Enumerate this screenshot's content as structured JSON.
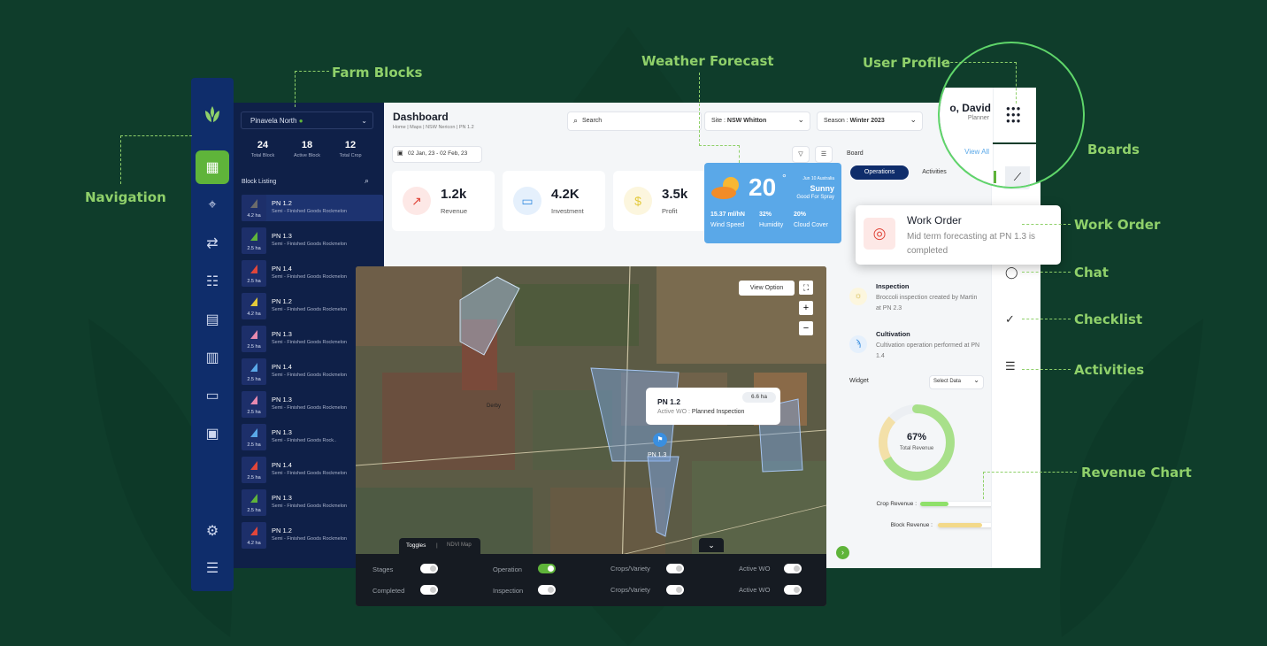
{
  "callouts": {
    "farm_blocks": "Farm Blocks",
    "weather": "Weather Forecast",
    "user_profile": "User Profile",
    "navigation": "Navigation",
    "boards": "Boards",
    "work_order": "Work Order",
    "chat": "Chat",
    "checklist": "Checklist",
    "activities": "Activities",
    "revenue_chart": "Revenue Chart"
  },
  "nav": {
    "icons": [
      "grid-icon",
      "map-pin-icon",
      "route-icon",
      "checklist-icon",
      "document-icon",
      "bar-chart-icon",
      "chat-icon",
      "calendar-icon",
      "settings-icon",
      "menu-icon"
    ]
  },
  "blocks": {
    "farm_select": "Pinavela North",
    "stats": [
      {
        "value": "24",
        "label": "Total Block"
      },
      {
        "value": "18",
        "label": "Active Block"
      },
      {
        "value": "12",
        "label": "Total Crop"
      }
    ],
    "listing_title": "Block Listing",
    "items": [
      {
        "name": "PN 1.2",
        "desc": "Semi - Finished Goods Rockmelon",
        "area": "4.2 ha",
        "color": "#6b6b6b"
      },
      {
        "name": "PN 1.3",
        "desc": "Semi - Finished Goods Rockmelon",
        "area": "2.5 ha",
        "color": "#5fb43a"
      },
      {
        "name": "PN 1.4",
        "desc": "Semi - Finished Goods Rockmelon",
        "area": "2.5 ha",
        "color": "#e0463a"
      },
      {
        "name": "PN 1.2",
        "desc": "Semi - Finished Goods Rockmelon",
        "area": "4.2 ha",
        "color": "#e3c93a"
      },
      {
        "name": "PN 1.3",
        "desc": "Semi - Finished Goods Rockmelon",
        "area": "2.5 ha",
        "color": "#e88ab0"
      },
      {
        "name": "PN 1.4",
        "desc": "Semi - Finished Goods Rockmelon",
        "area": "2.5 ha",
        "color": "#5aa8e8"
      },
      {
        "name": "PN 1.3",
        "desc": "Semi - Finished Goods Rockmelon",
        "area": "2.5 ha",
        "color": "#e88ab0"
      },
      {
        "name": "PN 1.3",
        "desc": "Semi - Finished Goods Rock..",
        "area": "2.5 ha",
        "color": "#5aa8e8"
      },
      {
        "name": "PN 1.4",
        "desc": "Semi - Finished Goods Rockmelon",
        "area": "2.5 ha",
        "color": "#e0463a"
      },
      {
        "name": "PN 1.3",
        "desc": "Semi - Finished Goods Rockmelon",
        "area": "2.5 ha",
        "color": "#5fb43a"
      },
      {
        "name": "PN 1.2",
        "desc": "Semi - Finished Goods Rockmelon",
        "area": "4.2 ha",
        "color": "#e0463a"
      }
    ]
  },
  "header": {
    "title": "Dashboard",
    "breadcrumb": "Home  |  Maps  |  NSW Nericon  |  PN 1.2",
    "search_placeholder": "Search",
    "site_label": "Site : ",
    "site_value": "NSW Whitton",
    "season_label": "Season : ",
    "season_value": "Winter 2023",
    "date_range": "02 Jan, 23 - 02 Feb, 23"
  },
  "kpis": [
    {
      "value": "1.2k",
      "label": "Revenue",
      "color": "#e0463a"
    },
    {
      "value": "4.2K",
      "label": "Investment",
      "color": "#3a8fe0"
    },
    {
      "value": "3.5k",
      "label": "Profit",
      "color": "#e3c93a"
    }
  ],
  "weather": {
    "temp": "20",
    "degree": "°",
    "location": "Jun 10 Australia",
    "condition": "Sunny",
    "note": "Good For Spray",
    "metrics": [
      {
        "value": "15.37 ml/hN",
        "label": "Wind Speed"
      },
      {
        "value": "32%",
        "label": "Humidity"
      },
      {
        "value": "20%",
        "label": "Cloud Cover"
      }
    ]
  },
  "board": {
    "label": "Board",
    "tabs": [
      "Operations",
      "Activities"
    ]
  },
  "profile": {
    "name": "o, David",
    "role": "Planner",
    "view_all": "View All"
  },
  "work_order": {
    "title": "Work Order",
    "text": "Mid term forecasting at PN 1.3 is completed"
  },
  "activities": [
    {
      "title": "Inspection",
      "text": "Broccoli inspection created by Martin at PN 2.3"
    },
    {
      "title": "Cultivation",
      "text": "Cultivation operation performed at PN 1.4"
    }
  ],
  "widget": {
    "label": "Widget",
    "select": "Select Data",
    "percent": 67,
    "percent_text": "67%",
    "sub": "Total Revenue",
    "bars": [
      {
        "label": "Crop Revenue :",
        "value": 0.32,
        "color": "#8fe06a"
      },
      {
        "label": "Block Revenue :",
        "value": 0.5,
        "color": "#f3d98a"
      }
    ]
  },
  "map": {
    "view_option": "View Option",
    "popup_title": "PN 1.2",
    "popup_area": "6.6 ha",
    "popup_label": "Active WO : ",
    "popup_value": "Planned Inspection",
    "pin_label": "PN 1.3",
    "town": "Derby",
    "tabs": [
      "Toggles",
      "NDVI Map"
    ],
    "toggles": [
      {
        "label": "Stages",
        "on": false
      },
      {
        "label": "Operation",
        "on": true
      },
      {
        "label": "Crops/Variety",
        "on": false
      },
      {
        "label": "Active WO",
        "on": false
      },
      {
        "label": "Completed",
        "on": false
      },
      {
        "label": "Inspection",
        "on": false
      },
      {
        "label": "Crops/Variety",
        "on": false
      },
      {
        "label": "Active WO",
        "on": false
      }
    ]
  }
}
